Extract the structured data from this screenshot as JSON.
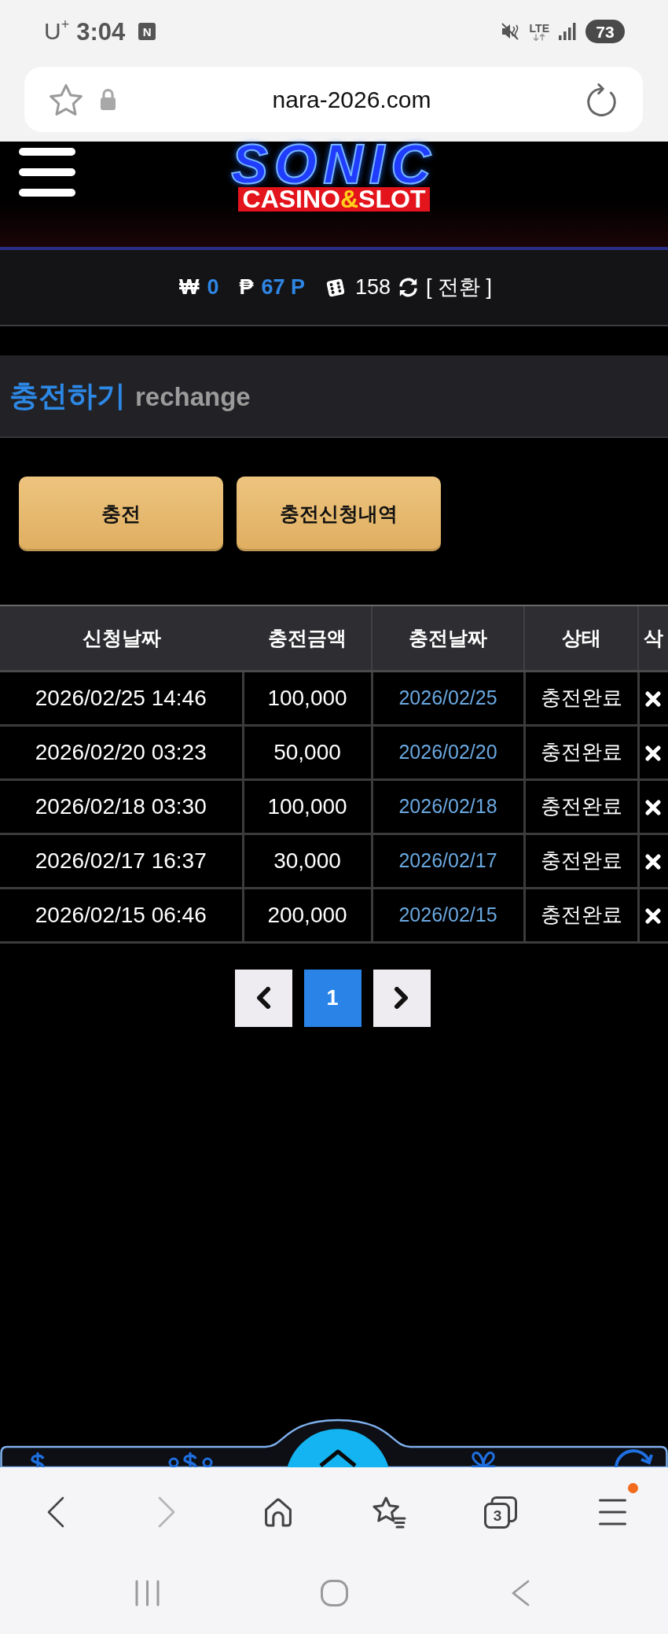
{
  "status_bar": {
    "carrier": "U$^{+}$",
    "time": "3:04",
    "notification": "N",
    "network": "LTE",
    "battery": "73"
  },
  "address_bar": {
    "url": "nara-2026.com"
  },
  "header": {
    "logo_title": "SONIC",
    "logo_subtitle": [
      {
        "text": "CASINO",
        "accent": false
      },
      {
        "text": "&",
        "accent": true
      },
      {
        "text": "SLOT",
        "accent": false
      }
    ]
  },
  "balance": {
    "cash_symbol": "₩",
    "cash": "0",
    "point_symbol": "₱",
    "points": "67 P",
    "chips": "158",
    "switch_label": "[ 전환 ]"
  },
  "page_title": {
    "title": "충전하기",
    "subtitle": "rechange"
  },
  "buttons": [
    {
      "label": "충전"
    },
    {
      "label": "충전신청내역"
    }
  ],
  "table": {
    "columns": [
      "신청날짜",
      "충전금액",
      "충전날짜",
      "상태",
      "삭"
    ],
    "rows": [
      {
        "cells": [
          "2026/02/25 14:46",
          "100,000",
          "2026/02/25",
          "충전완료"
        ]
      },
      {
        "cells": [
          "2026/02/20 03:23",
          "50,000",
          "2026/02/20",
          "충전완료"
        ]
      },
      {
        "cells": [
          "2026/02/18 03:30",
          "100,000",
          "2026/02/18",
          "충전완료"
        ]
      },
      {
        "cells": [
          "2026/02/17 16:37",
          "30,000",
          "2026/02/17",
          "충전완료"
        ]
      },
      {
        "cells": [
          "2026/02/15 06:46",
          "200,000",
          "2026/02/15",
          "충전완료"
        ]
      }
    ]
  },
  "pagination": {
    "pages": [
      {
        "label": "1",
        "selected": true
      }
    ]
  },
  "browser_toolbar": {
    "nav_buttons": [
      {
        "kind": "back",
        "disabled": false
      },
      {
        "kind": "forward",
        "disabled": true
      }
    ],
    "tab_count": "3",
    "menu_badge": true
  }
}
